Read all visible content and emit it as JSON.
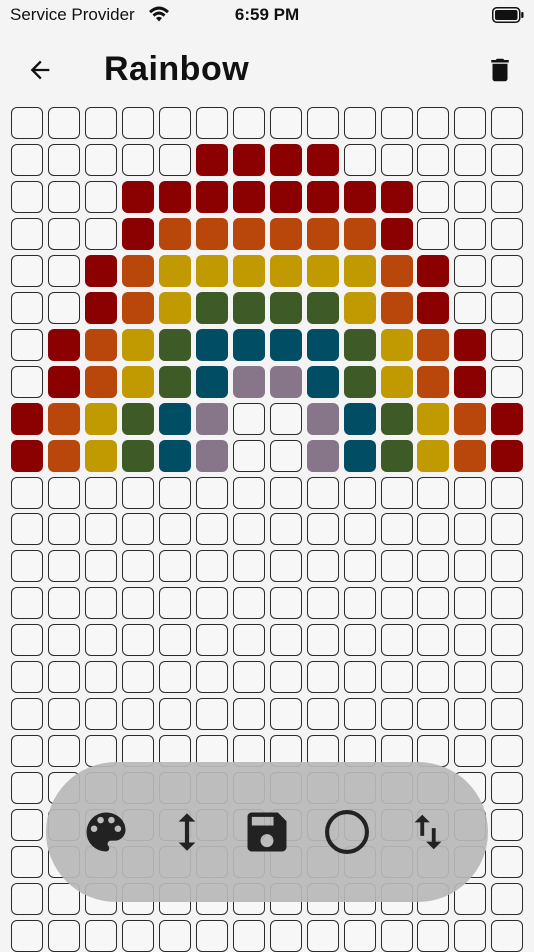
{
  "status_bar": {
    "carrier": "Service Provider",
    "time": "6:59 PM",
    "wifi_icon": "wifi-icon",
    "battery_icon": "battery-icon"
  },
  "header": {
    "title": "Rainbow",
    "back_icon": "arrow-left-icon",
    "delete_icon": "trash-icon"
  },
  "grid": {
    "columns": 14,
    "rows": 23,
    "empty_color": "#f7f7f7",
    "border_color": "#2a2a2a",
    "palette": {
      "R": "#8b0000",
      "O": "#b9460a",
      "Y": "#c09a00",
      "G": "#3d5a27",
      "B": "#004d64",
      "P": "#877589"
    },
    "pattern": [
      "..............",
      ".....RRRR.....",
      "...RRRRRRRR...",
      "...ROOOOOOR...",
      "..ROYYYYYYOR..",
      "..ROYGGGGYOR..",
      ".ROYGBBBBGYOR.",
      ".ROYGBPPBGYOR.",
      "ROYGBP..PBGYOR",
      "ROYGBP..PBGYOR"
    ]
  },
  "toolbar": {
    "background": "#b8b8b8",
    "icons": [
      "palette-icon",
      "vertical-arrows-icon",
      "save-icon",
      "circle-icon",
      "swap-vertical-icon"
    ]
  }
}
